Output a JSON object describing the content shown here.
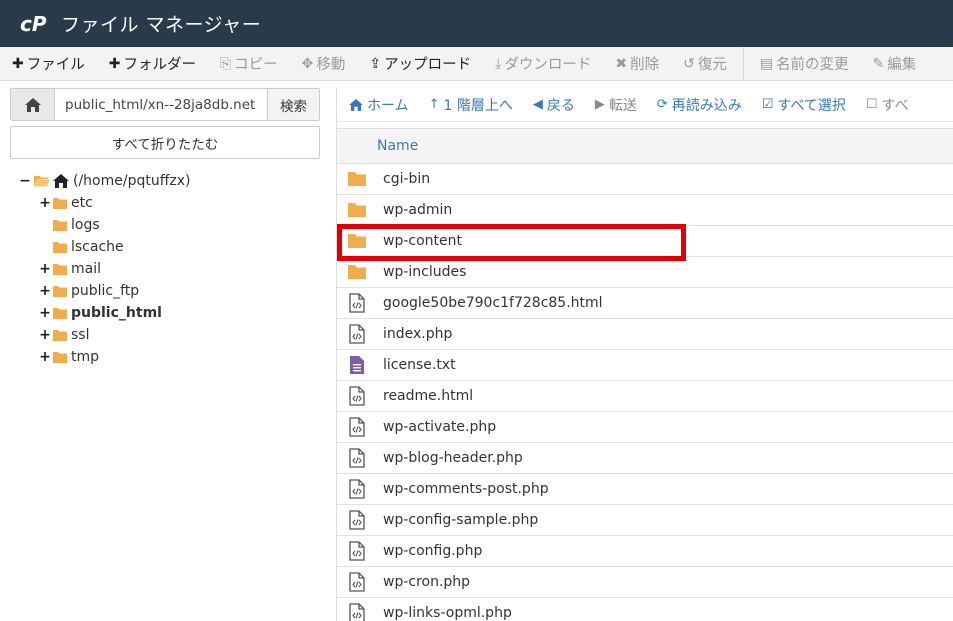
{
  "app": {
    "title": "ファイル マネージャー"
  },
  "toolbar": {
    "items": [
      {
        "label": "ファイル",
        "icon": "plus-icon",
        "disabled": false
      },
      {
        "label": "フォルダー",
        "icon": "plus-icon",
        "disabled": false
      },
      {
        "label": "コピー",
        "icon": "copy-icon",
        "disabled": true
      },
      {
        "label": "移動",
        "icon": "move-icon",
        "disabled": true
      },
      {
        "label": "アップロード",
        "icon": "upload-icon",
        "disabled": false
      },
      {
        "label": "ダウンロード",
        "icon": "download-icon",
        "disabled": true
      },
      {
        "label": "削除",
        "icon": "delete-icon",
        "disabled": true
      },
      {
        "label": "復元",
        "icon": "restore-icon",
        "disabled": true
      },
      {
        "label": "名前の変更",
        "icon": "file-icon",
        "disabled": true
      },
      {
        "label": "編集",
        "icon": "pencil-icon",
        "disabled": true
      }
    ]
  },
  "path": {
    "value": "public_html/xn--28ja8db.net",
    "search_label": "検索"
  },
  "collapse_label": "すべて折りたたむ",
  "tree": {
    "root_label": "(/home/pqtuffzx)",
    "items": [
      {
        "label": "etc",
        "expandable": true,
        "bold": false
      },
      {
        "label": "logs",
        "expandable": false,
        "bold": false
      },
      {
        "label": "lscache",
        "expandable": false,
        "bold": false
      },
      {
        "label": "mail",
        "expandable": true,
        "bold": false
      },
      {
        "label": "public_ftp",
        "expandable": true,
        "bold": false
      },
      {
        "label": "public_html",
        "expandable": true,
        "bold": true
      },
      {
        "label": "ssl",
        "expandable": true,
        "bold": false
      },
      {
        "label": "tmp",
        "expandable": true,
        "bold": false
      }
    ]
  },
  "nav": {
    "home": "ホーム",
    "up": "1 階層上へ",
    "back": "戻る",
    "forward": "転送",
    "reload": "再読み込み",
    "select_all": "すべて選択",
    "deselect_all": "すべ"
  },
  "table": {
    "header_name": "Name",
    "rows": [
      {
        "name": "cgi-bin",
        "type": "folder"
      },
      {
        "name": "wp-admin",
        "type": "folder"
      },
      {
        "name": "wp-content",
        "type": "folder"
      },
      {
        "name": "wp-includes",
        "type": "folder"
      },
      {
        "name": "google50be790c1f728c85.html",
        "type": "code"
      },
      {
        "name": "index.php",
        "type": "code"
      },
      {
        "name": "license.txt",
        "type": "text"
      },
      {
        "name": "readme.html",
        "type": "code"
      },
      {
        "name": "wp-activate.php",
        "type": "code"
      },
      {
        "name": "wp-blog-header.php",
        "type": "code"
      },
      {
        "name": "wp-comments-post.php",
        "type": "code"
      },
      {
        "name": "wp-config-sample.php",
        "type": "code"
      },
      {
        "name": "wp-config.php",
        "type": "code"
      },
      {
        "name": "wp-cron.php",
        "type": "code"
      },
      {
        "name": "wp-links-opml.php",
        "type": "code"
      }
    ]
  },
  "colors": {
    "header_bg": "#293a4a",
    "accent": "#3a79b7",
    "folder": "#f0ad4e",
    "text_file": "#7b5ea7",
    "highlight": "#e10000"
  }
}
